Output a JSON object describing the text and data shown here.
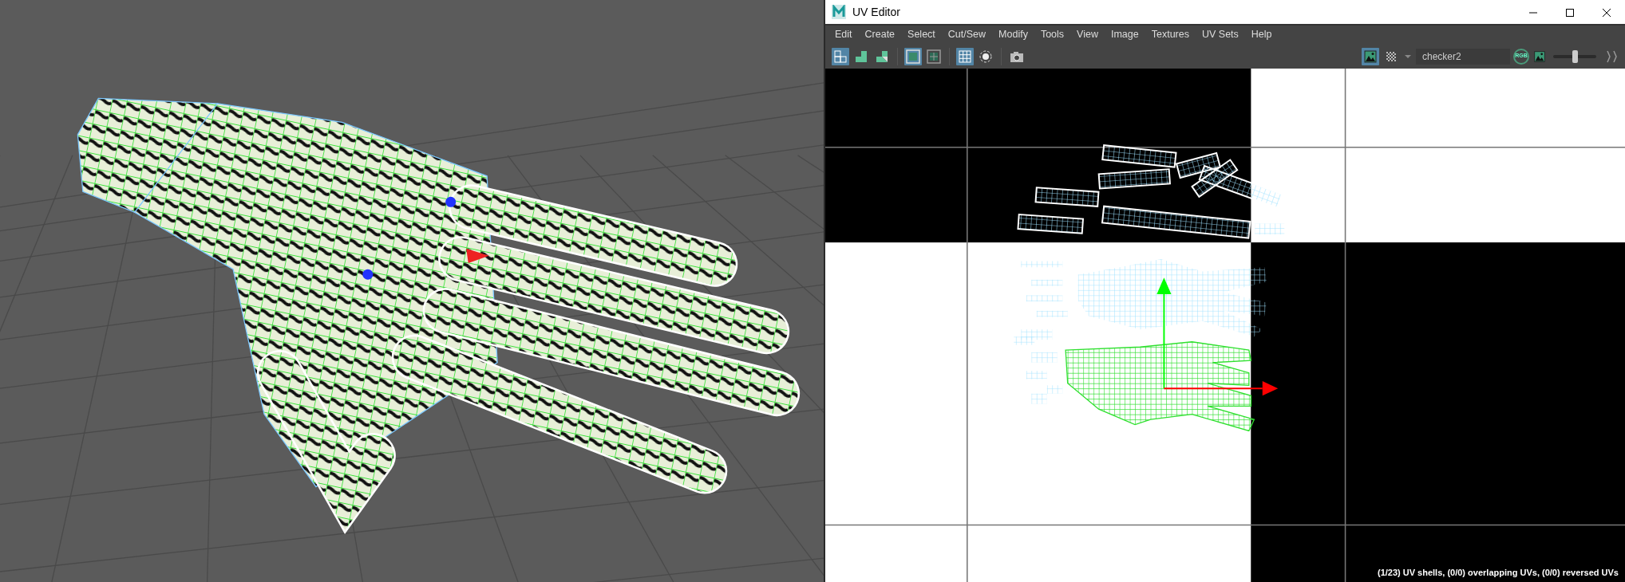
{
  "window": {
    "title": "UV Editor"
  },
  "menu": [
    "Edit",
    "Create",
    "Select",
    "Cut/Sew",
    "Modify",
    "Tools",
    "View",
    "Image",
    "Textures",
    "UV Sets",
    "Help"
  ],
  "toolbar": {
    "groups": [
      [
        {
          "kind": "shell-select",
          "selected": true
        },
        {
          "kind": "shell-fill",
          "selected": false
        },
        {
          "kind": "shell-partial",
          "selected": false
        }
      ],
      [
        {
          "kind": "frame",
          "selected": true
        },
        {
          "kind": "frame-grid",
          "selected": false
        }
      ],
      [
        {
          "kind": "grid",
          "selected": true
        },
        {
          "kind": "pivot",
          "selected": false
        }
      ],
      [
        {
          "kind": "camera",
          "selected": false
        }
      ]
    ],
    "right": [
      {
        "kind": "image",
        "selected": true
      },
      {
        "kind": "checker",
        "selected": false
      }
    ],
    "texture": {
      "value": "checker2"
    },
    "rgb": {
      "label": "RGB"
    },
    "exposure": {
      "level": 0.5
    }
  },
  "status": "(1/23) UV shells, (0/0) overlapping UVs, (0/0) reversed UVs"
}
